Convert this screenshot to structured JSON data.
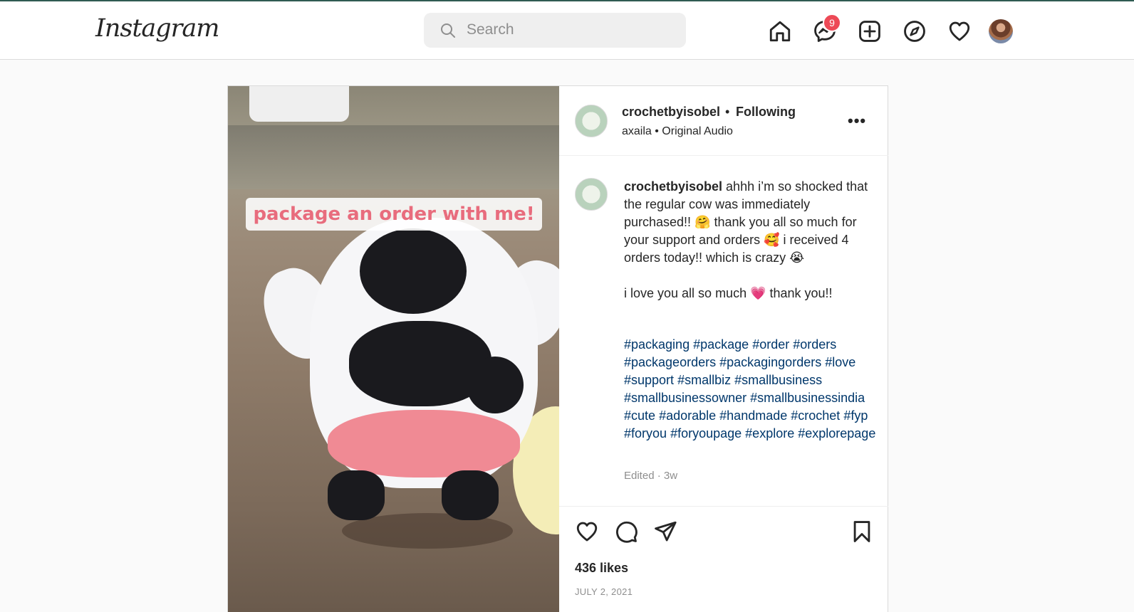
{
  "app": {
    "logo": "Instagram"
  },
  "search": {
    "placeholder": "Search"
  },
  "nav": {
    "icons": [
      "home-icon",
      "messenger-icon",
      "new-post-icon",
      "explore-icon",
      "activity-heart-icon",
      "profile-avatar"
    ],
    "messages_badge": "9"
  },
  "post": {
    "media_overlay_text": "package an order with me!",
    "header": {
      "username": "crochetbyisobel",
      "separator": "•",
      "follow_status": "Following",
      "audio": "axaila • Original Audio"
    },
    "caption": {
      "username": "crochetbyisobel",
      "text": " ahhh i’m so shocked that the regular cow was immediately purchased!! 🤗 thank you all so much for your support and orders 🥰 i received 4 orders today!! which is crazy 😭\n\ni love you all so much 💗 thank you!!",
      "hashtags": [
        "#packaging",
        "#package",
        "#order",
        "#orders",
        "#packageorders",
        "#packagingorders",
        "#love",
        "#support",
        "#smallbiz",
        "#smallbusiness",
        "#smallbusinessowner",
        "#smallbusinessindia",
        "#cute",
        "#adorable",
        "#handmade",
        "#crochet",
        "#fyp",
        "#foryou",
        "#foryoupage",
        "#explore",
        "#explorepage"
      ],
      "meta": "Edited · 3w"
    },
    "likes": "436 likes",
    "date": "JULY 2, 2021"
  },
  "colors": {
    "badge": "#ed4956",
    "hashtag": "#00376b",
    "overlay_text": "#e86c7d"
  }
}
